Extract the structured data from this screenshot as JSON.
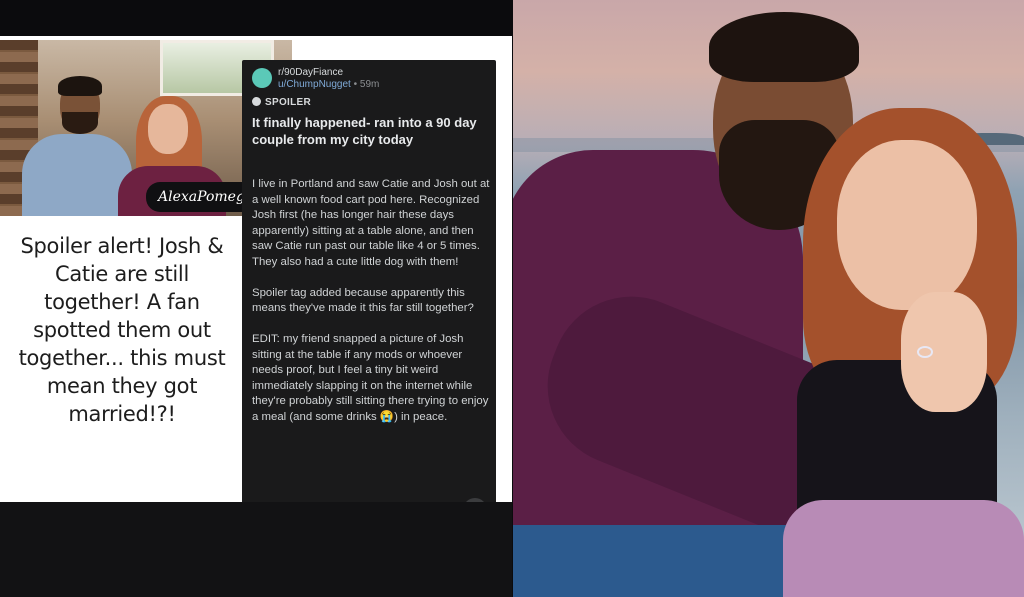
{
  "collage": {
    "watermark": "AlexaPomegranate",
    "headline": "Spoiler alert! Josh & Catie are still together! A fan spotted them out together... this must mean they got married!?!"
  },
  "reddit_post": {
    "subreddit": "r/90DayFiance",
    "username": "u/ChumpNugget",
    "age": "• 59m",
    "flair": "SPOILER",
    "title": "It finally happened- ran into a 90 day couple from my city today",
    "body": "I live in Portland and saw Catie and Josh out at a well known food cart pod here. Recognized Josh first (he has longer hair these days apparently) sitting at a table alone, and then saw Catie run past our table like 4 or 5 times. They also had a cute little dog with them!\n\nSpoiler tag added because apparently this means they've made it this far still together?\n\nEDIT: my friend snapped a picture of Josh sitting at the table if any mods or whoever needs proof, but I feel a tiny bit weird immediately slapping it on the internet while they're probably still sitting there trying to enjoy a meal (and some drinks 😭) in peace.",
    "expand_icon": "chevron-down-icon"
  },
  "colors": {
    "post_bg": "#1a1a1b",
    "username_link": "#7fa9d6",
    "skirt": "#b88bb6"
  }
}
